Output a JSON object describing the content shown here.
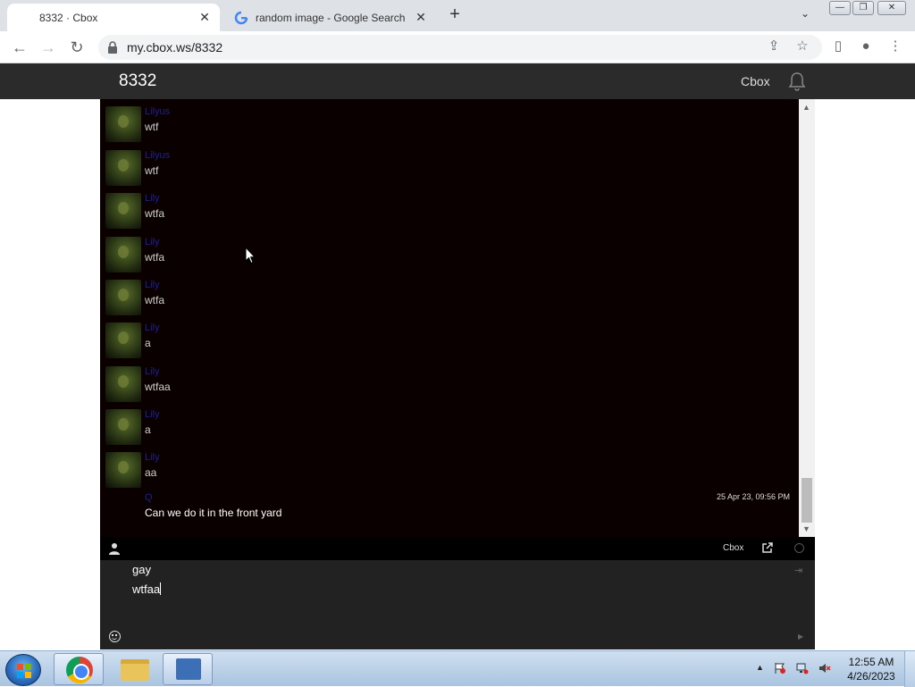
{
  "browser": {
    "tabs": [
      {
        "title": "8332 · Cbox",
        "active": true
      },
      {
        "title": "random image - Google Search",
        "active": false
      }
    ],
    "url": "my.cbox.ws/8332"
  },
  "site": {
    "title": "8332",
    "brand": "Cbox"
  },
  "chat": {
    "messages": [
      {
        "user": "Lilyus",
        "text": "wtf"
      },
      {
        "user": "Lilyus",
        "text": "wtf"
      },
      {
        "user": "Lily",
        "text": "wtfa"
      },
      {
        "user": "Lily",
        "text": "wtfa"
      },
      {
        "user": "Lily",
        "text": "wtfa"
      },
      {
        "user": "Lily",
        "text": "a"
      },
      {
        "user": "Lily",
        "text": "wtfaa"
      },
      {
        "user": "Lily",
        "text": "a"
      },
      {
        "user": "Lily",
        "text": "aa"
      },
      {
        "user": "Q",
        "text": "Can we do it in the front yard",
        "time": "25 Apr 23, 09:56 PM"
      }
    ]
  },
  "statusbar": {
    "brand": "Cbox"
  },
  "input": {
    "lines": [
      "gay",
      "wtfaa"
    ]
  },
  "taskbar": {
    "clock_time": "12:55 AM",
    "clock_date": "4/26/2023"
  },
  "icons": {
    "lock": "lock-icon",
    "bell": "bell-icon",
    "user": "user-icon",
    "external": "external-link-icon",
    "smiley": "smiley-icon",
    "send": "send-icon"
  }
}
